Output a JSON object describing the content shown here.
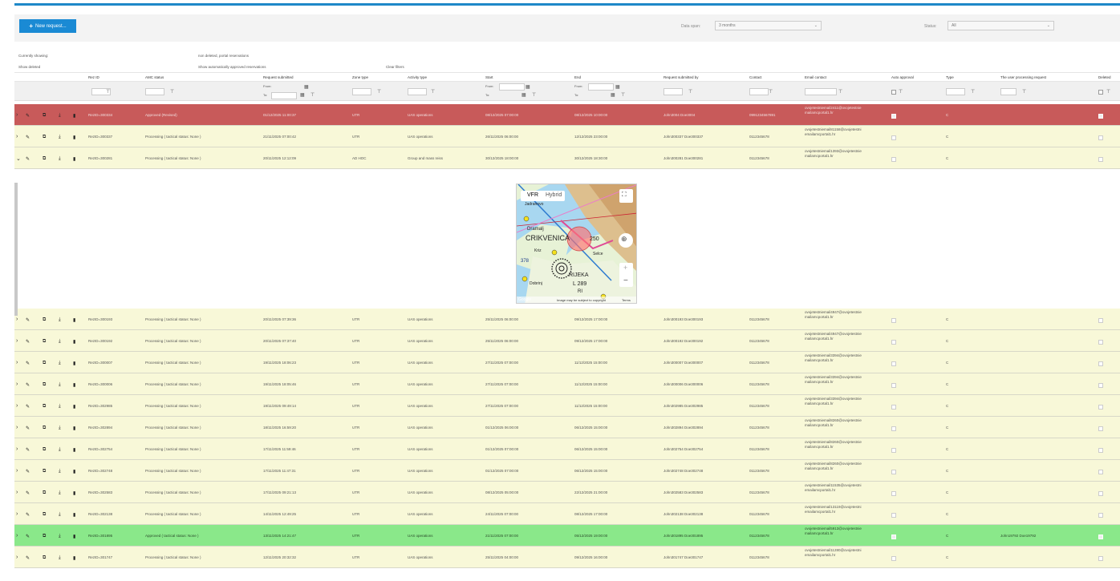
{
  "toolbar": {
    "new_request_label": "New request...",
    "data_span_label": "Data span:",
    "data_span_value": "3 months",
    "status_label": "Status:",
    "status_value": "All"
  },
  "info": {
    "currently_showing_label": "Currently showing:",
    "currently_showing_value": "non deleted, portal reservations",
    "show_deleted": "Show deleted",
    "show_auto_approved": "Show automatically approved reservations",
    "clear_filters": "Clear filters"
  },
  "columns": {
    "rez_id": "Rez ID",
    "amc_status": "AMC status",
    "request_submitted": "Request submitted",
    "zone_type": "Zone type",
    "activity_type": "Activity type",
    "start": "Start",
    "end": "End",
    "request_submitted_by": "Request submitted by",
    "contact": "Contact",
    "email_contact": "Email contact",
    "auto_approval": "Auto approval",
    "type": "Type",
    "user_processing": "The user processing request",
    "deleted": "Deleted"
  },
  "filters": {
    "from": "From:",
    "to": "To:"
  },
  "map": {
    "tab_vfr": "VFR",
    "tab_hybrid": "Hybrid",
    "label_crikvenica": "CRIKVENICA",
    "label_dramalj": "Dramalj",
    "label_rijeka": "RIJEKA",
    "label_l289": "L 289",
    "label_r": "RI",
    "label_250": "250",
    "label_378": "378",
    "label_dobrinj": "Dobrinj",
    "label_klenovica": "Jadranovo",
    "label_selce": "Selce",
    "label_kriz": "Kriz",
    "copyright": "Image may be subject to copyright",
    "terms": "Terms",
    "google": "Google"
  },
  "rows": [
    {
      "id": "RezID=300334",
      "status": "Approved (Revised)",
      "submitted": "01/12/2025 11:00:37",
      "zone": "UTR",
      "activity": "UAS operations",
      "start": "08/12/2025 07:00:00",
      "end": "08/12/2025 10:00:00",
      "by": "John3004 Doe3004",
      "contact": "0991234567891",
      "email": "ovojetestniemail2411@ovojetestniemailamcportal1.hr",
      "type": "C",
      "user": "",
      "color": "#c85a5a",
      "text": "#f2e0e0",
      "expanded": false,
      "auto": true,
      "deleted": true
    },
    {
      "id": "RezID=300337",
      "status": "Processing ( tactical status: None )",
      "submitted": "21/11/2025 07:00:42",
      "zone": "UTR",
      "activity": "UAS operations",
      "start": "26/11/2025 06:00:00",
      "end": "12/12/2025 23:00:00",
      "by": "John300337 Doe300337",
      "contact": "0112345678",
      "email": "ovojetestniemail81158@ovojetestniemailamcportal1.hr",
      "type": "C",
      "user": "",
      "color": "#f8f8d8",
      "text": "#555",
      "expanded": false,
      "auto": false,
      "deleted": false
    },
    {
      "id": "RezID=300281",
      "status": "Processing ( tactical status: None )",
      "submitted": "20/11/2025 12:12:09",
      "zone": "AD HOC",
      "activity": "Group and mass reiss",
      "start": "30/12/2025 18:00:00",
      "end": "30/12/2025 18:30:00",
      "by": "John300281 Doe300281",
      "contact": "0112345678",
      "email": "ovojetestniemail1393@ovojetestniemailamcportal1.hr",
      "type": "C",
      "user": "",
      "color": "#f8f8d8",
      "text": "#555",
      "expanded": true,
      "auto": false,
      "deleted": false
    },
    {
      "id": "RezID=300193",
      "status": "Processing ( tactical status: None )",
      "submitted": "20/11/2025 07:39:36",
      "zone": "UTR",
      "activity": "UAS operations",
      "start": "25/11/2025 06:00:00",
      "end": "09/12/2025 17:00:00",
      "by": "John300193 Doe300193",
      "contact": "0112345678",
      "email": "ovojetestniemail4947@ovojetestniemailamcportal1.hr",
      "type": "C",
      "user": "",
      "color": "#f8f8d8",
      "text": "#555",
      "expanded": false,
      "auto": false,
      "deleted": false
    },
    {
      "id": "RezID=300192",
      "status": "Processing ( tactical status: None )",
      "submitted": "20/11/2025 07:37:40",
      "zone": "UTR",
      "activity": "UAS operations",
      "start": "25/11/2025 06:00:00",
      "end": "09/12/2025 17:00:00",
      "by": "John300192 Doe300192",
      "contact": "0112345678",
      "email": "ovojetestniemail4947@ovojetestniemailamcportal1.hr",
      "type": "C",
      "user": "",
      "color": "#f8f8d8",
      "text": "#555",
      "expanded": false,
      "auto": false,
      "deleted": false
    },
    {
      "id": "RezID=300007",
      "status": "Processing ( tactical status: None )",
      "submitted": "19/11/2025 18:06:23",
      "zone": "UTR",
      "activity": "UAS operations",
      "start": "27/11/2025 07:00:00",
      "end": "11/12/2025 15:00:00",
      "by": "John300007 Doe300007",
      "contact": "0112345678",
      "email": "ovojetestniemail3394@ovojetestniemailamcportal1.hr",
      "type": "C",
      "user": "",
      "color": "#f8f8d8",
      "text": "#555",
      "expanded": false,
      "auto": false,
      "deleted": false
    },
    {
      "id": "RezID=300006",
      "status": "Processing ( tactical status: None )",
      "submitted": "19/11/2025 18:05:46",
      "zone": "UTR",
      "activity": "UAS operations",
      "start": "27/11/2025 07:00:00",
      "end": "11/12/2025 15:00:00",
      "by": "John300006 Doe300006",
      "contact": "0112345678",
      "email": "ovojetestniemail3394@ovojetestniemailamcportal1.hr",
      "type": "C",
      "user": "",
      "color": "#f8f8d8",
      "text": "#555",
      "expanded": false,
      "auto": false,
      "deleted": false
    },
    {
      "id": "RezID=302985",
      "status": "Processing ( tactical status: None )",
      "submitted": "19/11/2025 09:49:14",
      "zone": "UTR",
      "activity": "UAS operations",
      "start": "27/11/2025 07:00:00",
      "end": "11/12/2025 15:00:00",
      "by": "John302985 Doe302985",
      "contact": "0112345678",
      "email": "ovojetestniemail3394@ovojetestniemailamcportal1.hr",
      "type": "C",
      "user": "",
      "color": "#f8f8d8",
      "text": "#555",
      "expanded": false,
      "auto": false,
      "deleted": false
    },
    {
      "id": "RezID=302894",
      "status": "Processing ( tactical status: None )",
      "submitted": "18/11/2025 16:59:20",
      "zone": "UTR",
      "activity": "UAS operations",
      "start": "01/12/2025 06:00:00",
      "end": "06/12/2025 15:00:00",
      "by": "John302894 Doe302894",
      "contact": "0112345678",
      "email": "ovojetestniemail8260@ovojetestniemailamcportal1.hr",
      "type": "C",
      "user": "",
      "color": "#f8f8d8",
      "text": "#555",
      "expanded": false,
      "auto": false,
      "deleted": false
    },
    {
      "id": "RezID=302754",
      "status": "Processing ( tactical status: None )",
      "submitted": "17/11/2025 11:59:46",
      "zone": "UTR",
      "activity": "UAS operations",
      "start": "01/12/2025 07:00:00",
      "end": "06/12/2025 15:00:00",
      "by": "John302754 Doe302754",
      "contact": "0112345678",
      "email": "ovojetestniemail8260@ovojetestniemailamcportal1.hr",
      "type": "C",
      "user": "",
      "color": "#f8f8d8",
      "text": "#555",
      "expanded": false,
      "auto": false,
      "deleted": false
    },
    {
      "id": "RezID=302748",
      "status": "Processing ( tactical status: None )",
      "submitted": "17/11/2025 11:47:31",
      "zone": "UTR",
      "activity": "UAS operations",
      "start": "01/12/2025 07:00:00",
      "end": "06/12/2025 15:00:00",
      "by": "John302748 Doe302748",
      "contact": "0112345678",
      "email": "ovojetestniemail8260@ovojetestniemailamcportal1.hr",
      "type": "C",
      "user": "",
      "color": "#f8f8d8",
      "text": "#555",
      "expanded": false,
      "auto": false,
      "deleted": false
    },
    {
      "id": "RezID=302583",
      "status": "Processing ( tactical status: None )",
      "submitted": "17/11/2025 09:21:13",
      "zone": "UTR",
      "activity": "UAS operations",
      "start": "08/12/2025 05:00:00",
      "end": "22/12/2025 21:00:00",
      "by": "John302583 Doe302583",
      "contact": "0112345678",
      "email": "ovojetestniemail11535@ovojetestniemailamcportal1.hr",
      "type": "C",
      "user": "",
      "color": "#f8f8d8",
      "text": "#555",
      "expanded": false,
      "auto": false,
      "deleted": false
    },
    {
      "id": "RezID=302138",
      "status": "Processing ( tactical status: None )",
      "submitted": "14/11/2025 12:49:25",
      "zone": "UTR",
      "activity": "UAS operations",
      "start": "24/11/2025 07:00:00",
      "end": "08/12/2025 17:00:00",
      "by": "John302138 Doe302138",
      "contact": "0112345678",
      "email": "ovojetestniemail13119@ovojetestniemailamcportal1.hr",
      "type": "C",
      "user": "",
      "color": "#f8f8d8",
      "text": "#555",
      "expanded": false,
      "auto": false,
      "deleted": false
    },
    {
      "id": "RezID=301895",
      "status": "Approved ( tactical status: None )",
      "submitted": "13/11/2025 14:21:47",
      "zone": "UTR",
      "activity": "UAS operations",
      "start": "21/11/2025 07:00:00",
      "end": "05/12/2025 19:00:00",
      "by": "John301895 Doe301895",
      "contact": "0112345678",
      "email": "ovojetestniemail5913@ovojetestniemailamcportal1.hr",
      "type": "C",
      "user": "John19792 Doe19792",
      "color": "#8ae88a",
      "text": "#2a4a2a",
      "expanded": false,
      "auto": true,
      "deleted": true
    },
    {
      "id": "RezID=301747",
      "status": "Processing ( tactical status: None )",
      "submitted": "12/11/2025 20:32:32",
      "zone": "UTR",
      "activity": "UAS operations",
      "start": "25/11/2025 04:00:00",
      "end": "09/12/2025 16:00:00",
      "by": "John301747 Doe301747",
      "contact": "0112345678",
      "email": "ovojetestniemail11280@ovojetestniemailamcportal1.hr",
      "type": "C",
      "user": "",
      "color": "#f8f8d8",
      "text": "#555",
      "expanded": false,
      "auto": false,
      "deleted": false
    }
  ]
}
